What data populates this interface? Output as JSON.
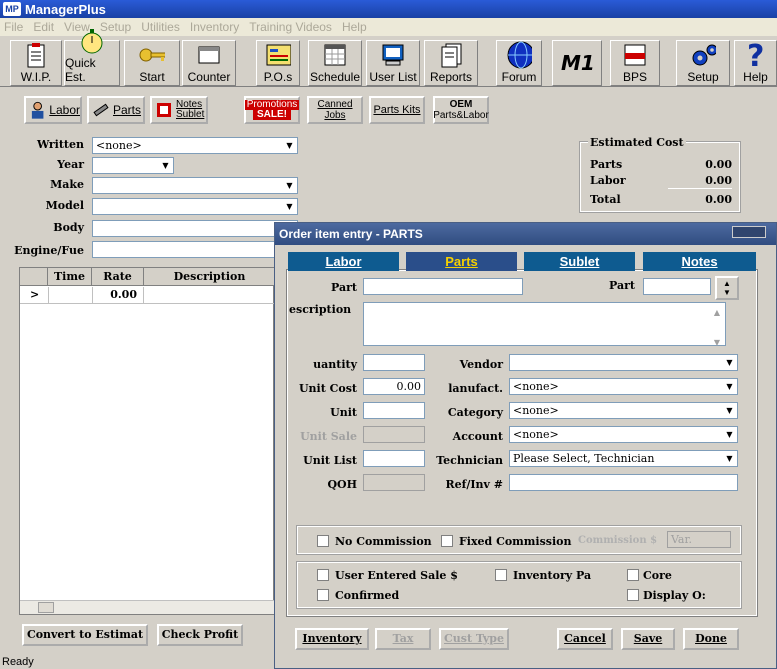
{
  "app": {
    "title": "ManagerPlus",
    "logo_text": "MP",
    "status": "Ready"
  },
  "menu": [
    "File",
    "Edit",
    "View",
    "Setup",
    "Utilities",
    "Inventory",
    "Training Videos",
    "Help"
  ],
  "toolbar": [
    {
      "label": "W.I.P.",
      "icon": "clipboard-icon"
    },
    {
      "label": "Quick Est.",
      "icon": "stopwatch-icon"
    },
    {
      "label": "Start",
      "icon": "key-icon"
    },
    {
      "label": "Counter",
      "icon": "counter-icon"
    },
    {
      "label": "P.O.s",
      "icon": "purchase-order-icon"
    },
    {
      "label": "Schedule",
      "icon": "calendar-icon"
    },
    {
      "label": "User List",
      "icon": "computer-icon"
    },
    {
      "label": "Reports",
      "icon": "reports-icon"
    },
    {
      "label": "Forum",
      "icon": "globe-icon"
    },
    {
      "label": "M1",
      "icon": "m1-logo-icon"
    },
    {
      "label": "BPS",
      "icon": "bps-icon"
    },
    {
      "label": "Setup",
      "icon": "gears-icon"
    },
    {
      "label": "Help",
      "icon": "question-icon"
    }
  ],
  "secondary": {
    "labor": "Labor",
    "parts": "Parts",
    "notes_1": "Notes",
    "notes_2": "Sublet",
    "promotions_1": "Promotions",
    "promotions_2": "SALE!",
    "canned_1": "Canned",
    "canned_2": "Jobs",
    "partskits": "Parts Kits",
    "oem_1": "OEM",
    "oem_2": "Parts&Labor"
  },
  "vehicle": {
    "written": {
      "label": "Written",
      "value": "<none>"
    },
    "year": {
      "label": "Year",
      "value": ""
    },
    "make": {
      "label": "Make",
      "value": ""
    },
    "model": {
      "label": "Model",
      "value": ""
    },
    "body": {
      "label": "Body",
      "value": ""
    },
    "engine": {
      "label": "Engine/Fue",
      "value": ""
    }
  },
  "estimate": {
    "title": "Estimated Cost",
    "rows": [
      {
        "label": "Parts",
        "value": "0.00"
      },
      {
        "label": "Labor",
        "value": "0.00"
      },
      {
        "label": "Total",
        "value": "0.00"
      }
    ]
  },
  "grid": {
    "columns": [
      "Time",
      "Rate",
      "Description"
    ],
    "row": {
      "marker": ">",
      "time": "",
      "rate": "0.00",
      "description": ""
    }
  },
  "main_buttons": {
    "convert": "Convert to Estimat",
    "check": "Check Profit"
  },
  "dialog": {
    "title": "Order item entry - PARTS",
    "tabs": [
      {
        "label": "Labor"
      },
      {
        "label": "Parts"
      },
      {
        "label": "Sublet"
      },
      {
        "label": "Notes"
      }
    ],
    "fields": {
      "part_label": "Part",
      "part2_label": "Part",
      "description_label": "escription",
      "quantity_label": "uantity",
      "unit_cost_label": "Unit Cost",
      "unit_cost_value": "0.00",
      "unit_label": "Unit",
      "unit_sale_label": "Unit Sale",
      "unit_list_label": "Unit List",
      "qoh_label": "QOH",
      "vendor_label": "Vendor",
      "vendor_value": "",
      "manufact_label": "lanufact.",
      "manufact_value": "<none>",
      "category_label": "Category",
      "category_value": "<none>",
      "account_label": "Account",
      "account_value": "<none>",
      "technician_label": "Technician",
      "technician_value": "Please Select, Technician",
      "refinv_label": "Ref/Inv #"
    },
    "commission": {
      "no_commission": "No Commission",
      "fixed_commission": "Fixed Commission",
      "commission_label": "Commission $",
      "commission_value": "Var."
    },
    "options": {
      "user_entered": "User Entered Sale $",
      "inventory": "Inventory Pa",
      "core": "Core",
      "confirmed": "Confirmed",
      "display": "Display O:"
    },
    "buttons": {
      "inventory": "Inventory",
      "tax": "Tax",
      "cust_type": "Cust Type",
      "cancel": "Cancel",
      "save": "Save",
      "done": "Done"
    }
  }
}
